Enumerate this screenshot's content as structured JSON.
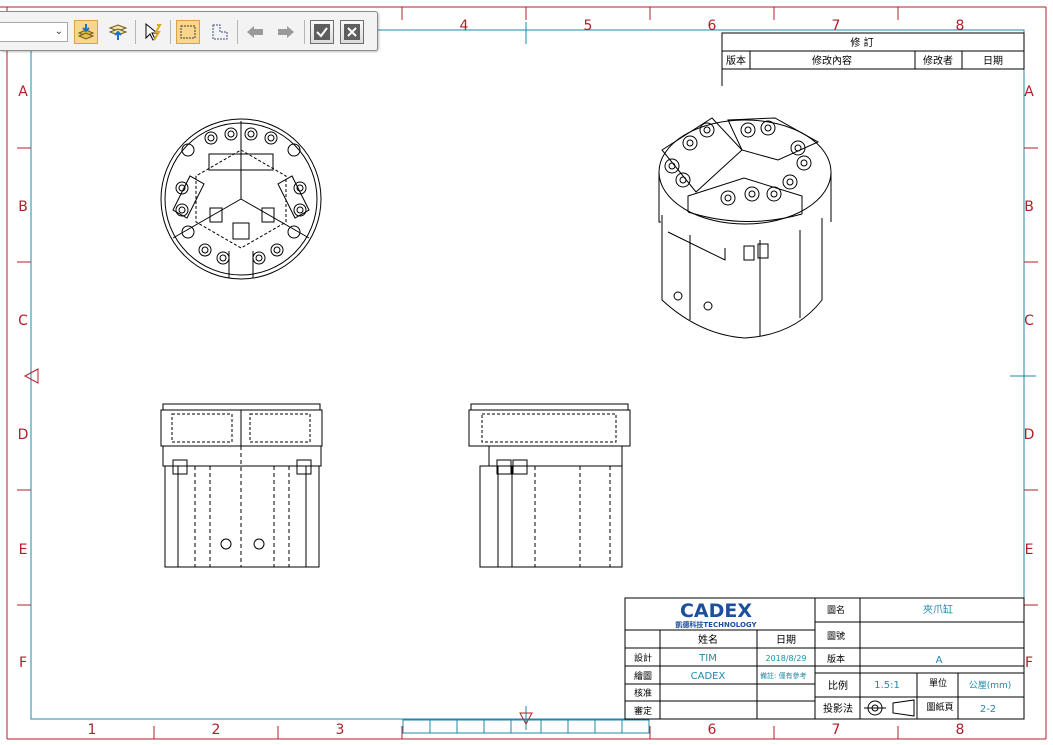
{
  "toolbar": {
    "select_value": "",
    "buttons": [
      "layers-down-icon",
      "layers-up-icon",
      "cursor-select-icon",
      "rectangle-select-icon",
      "polygon-select-icon",
      "arrow-left-icon",
      "arrow-right-icon",
      "confirm-icon",
      "cancel-icon"
    ]
  },
  "border": {
    "columns_top": [
      "4",
      "5",
      "6",
      "7",
      "8"
    ],
    "columns_bottom": [
      "1",
      "2",
      "3",
      "6",
      "7",
      "8"
    ],
    "rows": [
      "A",
      "B",
      "C",
      "D",
      "E",
      "F"
    ]
  },
  "revision": {
    "title": "修 訂",
    "headers": [
      "版本",
      "修改內容",
      "修改者",
      "日期"
    ]
  },
  "title_block": {
    "logo": "CADEX",
    "logo_sub": "凱德科技TECHNOLOGY",
    "col_name": "姓名",
    "col_date": "日期",
    "rows": [
      {
        "label": "設計",
        "name": "TIM",
        "date": "2018/8/29"
      },
      {
        "label": "繪圖",
        "name": "CADEX",
        "date": "備註: 僅有參考"
      },
      {
        "label": "核准",
        "name": "",
        "date": ""
      },
      {
        "label": "審定",
        "name": "",
        "date": ""
      }
    ],
    "drawing_name_label": "圖名",
    "drawing_name_value": "夾爪缸",
    "drawing_no_label": "圖號",
    "drawing_no_value": "",
    "version_label": "版本",
    "version_value": "A",
    "scale_label": "比例",
    "scale_value": "1.5:1",
    "unit_label": "單位",
    "unit_value": "公厘(mm)",
    "projection_label": "投影法",
    "sheet_label": "圖紙頁",
    "sheet_value": "2-2"
  },
  "colors": {
    "frame": "#b0202a",
    "inner": "#1e8aa8",
    "cad_text": "#1e8aa8",
    "line": "#000000",
    "logo": "#1c4f9c"
  }
}
